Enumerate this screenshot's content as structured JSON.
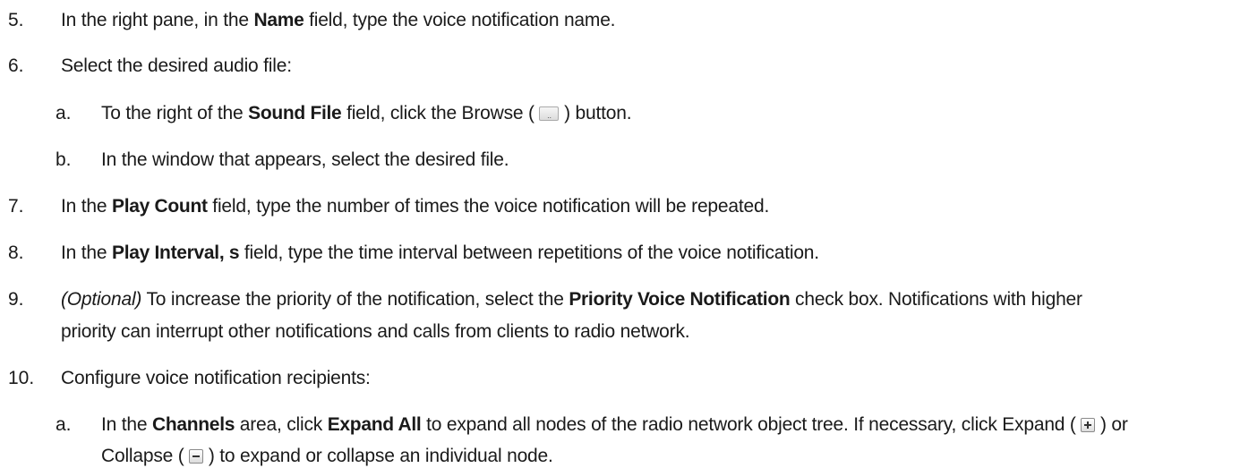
{
  "steps": [
    {
      "number": "5.",
      "lines": [
        [
          "In the right pane, in the ",
          {
            "b": "Name"
          },
          " field, type the voice notification name."
        ]
      ]
    },
    {
      "number": "6.",
      "lines": [
        [
          "Select the desired audio file:"
        ]
      ]
    },
    {
      "number": "a.",
      "lines": [
        [
          "To the right of the ",
          {
            "b": "Sound File"
          },
          " field, click the Browse ( ",
          {
            "icon": "browse-icon"
          },
          " ) button."
        ]
      ]
    },
    {
      "number": "b.",
      "lines": [
        [
          "In the window that appears, select the desired file."
        ]
      ]
    },
    {
      "number": "7.",
      "lines": [
        [
          "In the ",
          {
            "b": "Play Count"
          },
          " field, type the number of times the voice notification will be repeated."
        ]
      ]
    },
    {
      "number": "8.",
      "lines": [
        [
          "In the ",
          {
            "b": "Play Interval, s"
          },
          " field, type the time interval between repetitions of the voice notification."
        ]
      ]
    },
    {
      "number": "9.",
      "lines": [
        [
          {
            "i": "(Optional)"
          },
          " To increase the priority of the notification, select the ",
          {
            "b": "Priority Voice Notification"
          },
          " check box. Notifications with higher"
        ],
        [
          "priority can interrupt other notifications and calls from clients to radio network."
        ]
      ]
    },
    {
      "number": "10.",
      "lines": [
        [
          "Configure voice notification recipients:"
        ]
      ]
    },
    {
      "number": "a.",
      "lines": [
        [
          "In the ",
          {
            "b": "Channels"
          },
          " area, click ",
          {
            "b": "Expand All"
          },
          " to expand all nodes of the radio network object tree. If necessary, click Expand ( ",
          {
            "icon": "expand-icon"
          },
          " ) or"
        ],
        [
          "Collapse ( ",
          {
            "icon": "collapse-icon"
          },
          " ) to expand or collapse an individual node."
        ]
      ]
    }
  ]
}
